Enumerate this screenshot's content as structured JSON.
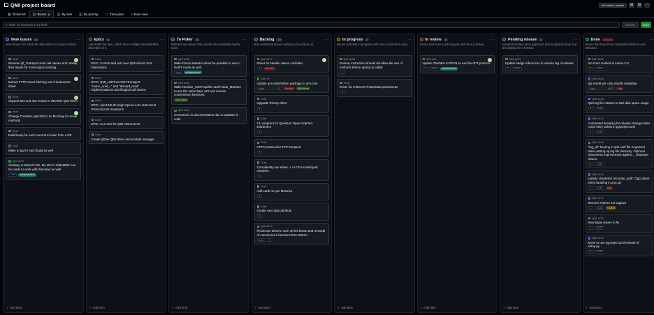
{
  "header": {
    "title": "QMI project board",
    "add_status_label": "Add status update"
  },
  "tabs": [
    {
      "label": "Ticket list",
      "icon": "table-icon"
    },
    {
      "label": "Board",
      "icon": "board-icon",
      "active": true
    },
    {
      "label": "By size",
      "icon": "board-icon"
    },
    {
      "label": "By priority",
      "icon": "board-icon"
    },
    {
      "label": "Time plan",
      "icon": "roadmap-icon"
    },
    {
      "label": "New view",
      "icon": "plus-icon"
    }
  ],
  "filter": {
    "placeholder": "Filter by keyword or by field",
    "discard_label": "Discard",
    "save_label": "Save"
  },
  "add_item_label": "Add item",
  "columns": [
    {
      "name": "New issues",
      "count": "8",
      "color": "#58a6ff",
      "desc": "New issues, for which the description is not yet refined.",
      "cards": [
        {
          "id": "Draft",
          "title": "Rename @_Transport read call names and modify their inputs for more logical naming",
          "avatar": "tan"
        },
        {
          "id": "Draft",
          "title": "Extract FTTR event fetching out of instrument driver",
          "avatar": "tan"
        },
        {
          "id": "Draft",
          "title": "Support 8x2 and 3x8 modes in HDAWG QMI driver",
          "avatar": "tan"
        },
        {
          "id": "Draft",
          "title": "Change Thorlabs_Mpc320 to be blocking for move methods",
          "avatar": "green"
        },
        {
          "id": "Draft",
          "title": "build bump for each commit to main from a PR"
        },
        {
          "id": "Draft",
          "title": "Make a tag for each build as well"
        },
        {
          "id": "QMI #137",
          "open": true,
          "title": "Similarly to Bristol FOS, the MCC USB1808X can be made to work with Windows as well",
          "pills": [
            "Low"
          ],
          "labels": [
            {
              "text": "enhancement",
              "bg": "#1f6f6a",
              "fg": "#a6f2e8"
            }
          ]
        }
      ]
    },
    {
      "name": "Epics",
      "count": "5",
      "color": "#3fb950",
      "desc": "Label with the Epic, which have multiple issues/tickets described in it.",
      "cards": [
        {
          "id": "Draft",
          "title": "EPIC: Control and port over QMI drivers from Diamondos"
        },
        {
          "id": "Draft",
          "title": "EPIC: QMI_UsbTmcVXI11Transport \"read+_until_+\" and \"discard_read\" implementations and illogical call names"
        },
        {
          "id": "Draft",
          "title": "EPIC: Add HISLIP (High-Speed LAN Instrument Protocol) into transports"
        },
        {
          "id": "Draft",
          "title": "EPIC: CLI tools for QMI instruments"
        },
        {
          "id": "Draft",
          "title": "Create Qblox QMI driver and module manager"
        }
      ]
    },
    {
      "name": "To Poker",
      "count": "3",
      "color": "#8b949e",
      "desc": "Refined new issues that can be size-estimated by the team.",
      "cards": [
        {
          "id": "QMI #155",
          "open": true,
          "title": "Make Pololu Maestro driver be possible to use in UART mode as well.",
          "pills": [
            "Low"
          ],
          "labels": [
            {
              "text": "enhancement",
              "bg": "#1f6f6a",
              "fg": "#a6f2e8"
            }
          ]
        },
        {
          "id": "QMI #150",
          "open": true,
          "title": "Make Newline_UsbPropeller and Pololu_Maestro to use the same base API and remove convenience functions.",
          "labels": [
            {
              "text": "QMI driver",
              "bg": "#2d4a1e",
              "fg": "#9be07a"
            }
          ]
        },
        {
          "id": "QMI #152",
          "open": true,
          "title": "Corrections in documentation due to updates in code"
        }
      ]
    },
    {
      "name": "Backlog",
      "count": "10",
      "color": "#8b949e",
      "desc": "Size-estimated issues waiting to be picked up.",
      "cards": [
        {
          "id": "QMI #117",
          "open": true,
          "title": "Driver for Nankin valves controller",
          "avatar": "green",
          "pills": [
            "1"
          ],
          "labels": [
            {
              "text": "blocked",
              "bg": "#5a1d1d",
              "fg": "#ff7b72"
            }
          ]
        },
        {
          "id": "QMI #77",
          "open": true,
          "title": "Update qmi.utils/Python package to qmi.core",
          "pills": [
            "High",
            "1",
            "1/3"
          ],
          "labels": [
            {
              "text": "blocked",
              "bg": "#5a1d1d",
              "fg": "#ff7b72"
            },
            {
              "text": "QMI driver",
              "bg": "#2d4a1e",
              "fg": "#9be07a"
            }
          ]
        },
        {
          "id": "Draft",
          "title": "Upgrade PiGrey driver",
          "pills": [
            "1"
          ]
        },
        {
          "id": "Draft",
          "title": "CLI program for Quantum Opus AmpGen instrument",
          "pills": [
            "2"
          ]
        },
        {
          "id": "Draft",
          "title": "HTTP protocol for TCP transport",
          "pills": [
            "3"
          ]
        },
        {
          "id": "Draft",
          "title": "Consistently use either -1 or 0 for invalid port numbers.",
          "pills": [
            "1"
          ]
        },
        {
          "id": "Draft",
          "title": "Add cards to qmi factories",
          "pills": [
            "1"
          ]
        },
        {
          "id": "Draft",
          "title": "Create user data attribute",
          "pills": [
            "1"
          ]
        },
        {
          "id": "QMI #123",
          "open": true,
          "title": "Picoscope drivers more series-based and removal of convenience functions from 340XA",
          "pills": [
            "Low",
            "3"
          ]
        }
      ]
    },
    {
      "name": "In progress",
      "count": "2",
      "color": "#d29922",
      "desc": "Issues currently in progress and have a branch in repo.",
      "cards": [
        {
          "id": "QMI #159",
          "open": true,
          "title": "Dummy instrument should not allow the use of methods before open() is called",
          "pills": [
            "1"
          ]
        },
        {
          "id": "Draft",
          "title": "Driver for Coherent PowerMax powermeter",
          "pills": [
            "2"
          ]
        }
      ]
    },
    {
      "name": "In review",
      "count": "1",
      "color": "#db6d28",
      "desc": "Issues that have a pull request and need a review.",
      "cards": [
        {
          "id": "QMI #81",
          "open": true,
          "title": "Update Thorlabs K10CR1 to use the APT protocol",
          "avatar": "tan",
          "pills": [
            "1",
            "#154"
          ],
          "labels": [
            {
              "text": "enhancement",
              "bg": "#1f6f6a",
              "fg": "#a6f2e8"
            }
          ]
        }
      ]
    },
    {
      "name": "Pending release",
      "count": "1",
      "color": "#a371f7",
      "desc": "Issues that have been approved and merged to main, but are waiting for a release.",
      "cards": [
        {
          "id": "QMI #151",
          "open": true,
          "title": "Update badge references to version tag of release",
          "pills": [
            "1",
            "#152"
          ]
        }
      ]
    },
    {
      "name": "Done",
      "count": "40 / 40",
      "color": "#3fb950",
      "red": true,
      "desc": "Issues that have been completely finished and released.",
      "cards": [
        {
          "id": "QMI #104",
          "done": true,
          "title": "Incorrect method in sonnu CLI",
          "pills": [
            "1",
            "#112"
          ]
        },
        {
          "id": "QMI #158",
          "done": true,
          "title": "pip install qmi only installs metadata",
          "pills": [
            "High",
            "1",
            "#150"
          ],
          "labels": [
            {
              "text": "bug",
              "bg": "#5a1d1d",
              "fg": "#ff7b72"
            }
          ]
        },
        {
          "id": "QMI #148",
          "done": true,
          "title": "QMI log file rotation to limit disk space usage",
          "pills": [
            "1",
            "#149"
          ]
        },
        {
          "id": "QMI #142",
          "done": true,
          "title": "Automated bumping for release changed also script entry points in pyproject.toml",
          "pills": [
            "1",
            "#143"
          ]
        },
        {
          "id": "QMI #140",
          "done": true,
          "title": "\"log_dir\" keyring in qmi.conf file is ignored when setting up log file directory. Optional robustness improvement against _ character issues.",
          "pills": [
            "1",
            "#141"
          ]
        },
        {
          "id": "QMI #134",
          "done": true,
          "title": "Update obsoleted 'simulate_path' CfgContext entry handling in proc.py",
          "pills": [
            "1",
            "#135"
          ],
          "labels": [
            {
              "text": "bug",
              "bg": "#5a1d1d",
              "fg": "#ff7b72"
            }
          ]
        },
        {
          "id": "QMI #127",
          "done": true,
          "title": "Remove Python 3.8 support",
          "pills": [
            "1",
            "#128"
          ],
          "labels": [
            {
              "text": "Urgent",
              "bg": "#5a4a0e",
              "fg": "#e3c44d"
            }
          ]
        },
        {
          "id": "QMI #130",
          "done": true,
          "title": "New Mypy issues to fix",
          "pills": [
            "1",
            "#131"
          ]
        },
        {
          "id": "QMI #125",
          "done": true,
          "title": "Move to use pyproject.toml instead of setup.py",
          "pills": [
            "1",
            "#126"
          ]
        }
      ]
    }
  ]
}
